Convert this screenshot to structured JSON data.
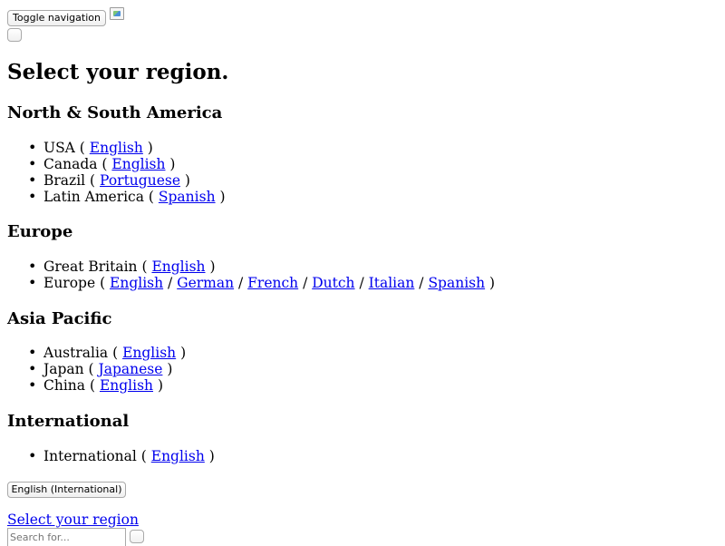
{
  "navbar": {
    "toggle_label": "Toggle navigation"
  },
  "page_title": "Select your region.",
  "regions": [
    {
      "name": "North & South America",
      "countries": [
        {
          "name": "USA",
          "languages": [
            "English"
          ]
        },
        {
          "name": "Canada",
          "languages": [
            "English"
          ]
        },
        {
          "name": "Brazil",
          "languages": [
            "Portuguese"
          ]
        },
        {
          "name": "Latin America",
          "languages": [
            "Spanish"
          ]
        }
      ]
    },
    {
      "name": "Europe",
      "countries": [
        {
          "name": "Great Britain",
          "languages": [
            "English"
          ]
        },
        {
          "name": "Europe",
          "languages": [
            "English",
            "German",
            "French",
            "Dutch",
            "Italian",
            "Spanish"
          ]
        }
      ]
    },
    {
      "name": "Asia Pacific",
      "countries": [
        {
          "name": "Australia",
          "languages": [
            "English"
          ]
        },
        {
          "name": "Japan",
          "languages": [
            "Japanese"
          ]
        },
        {
          "name": "China",
          "languages": [
            "English"
          ]
        }
      ]
    },
    {
      "name": "International",
      "countries": [
        {
          "name": "International",
          "languages": [
            "English"
          ]
        }
      ]
    }
  ],
  "footer": {
    "language_button": "English (International)",
    "select_region_link": "Select your region",
    "search_placeholder": "Search for..."
  },
  "colors": {
    "link": "#0000ee",
    "text": "#000000",
    "background": "#ffffff"
  }
}
